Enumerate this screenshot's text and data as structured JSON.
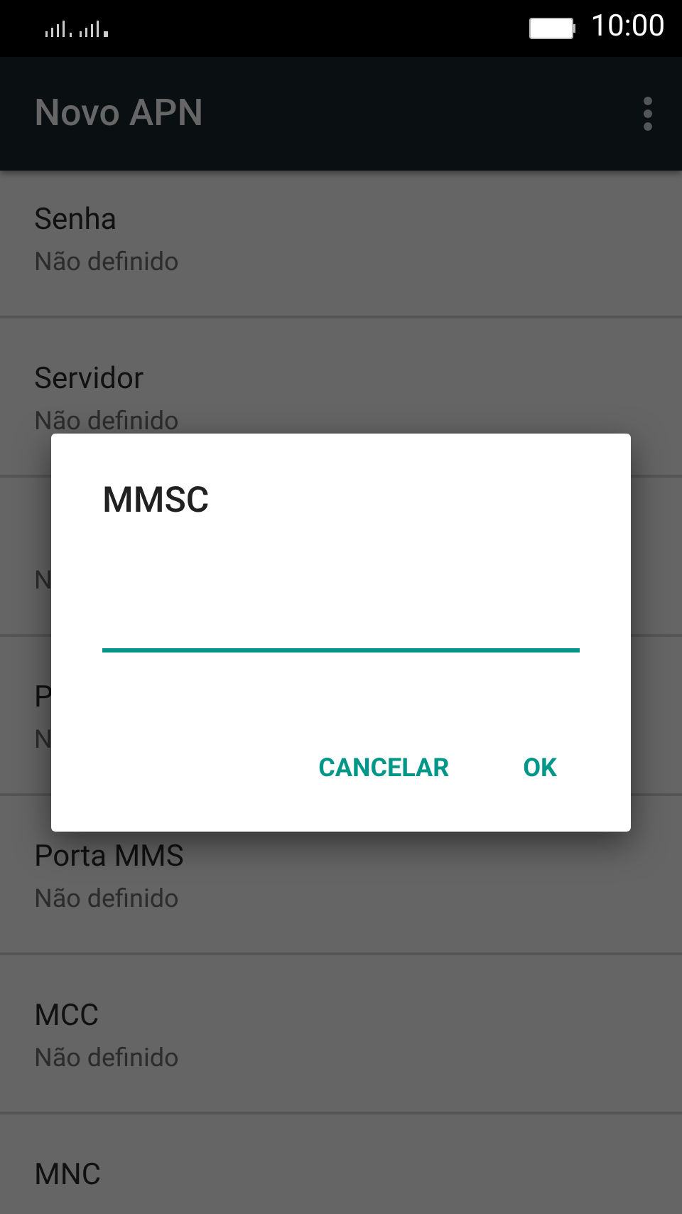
{
  "status_bar": {
    "time": "10:00"
  },
  "toolbar": {
    "title": "Novo APN"
  },
  "items": [
    {
      "title": "Senha",
      "summary": "Não definido"
    },
    {
      "title": "Servidor",
      "summary": "Não definido"
    },
    {
      "summary": "N"
    },
    {
      "title": "P",
      "summary": "N"
    },
    {
      "title": "Porta MMS",
      "summary": "Não definido"
    },
    {
      "title": "MCC",
      "summary": "Não definido"
    },
    {
      "title": "MNC"
    }
  ],
  "dialog": {
    "title": "MMSC",
    "buttons": [
      "CANCELAR",
      "OK"
    ]
  }
}
